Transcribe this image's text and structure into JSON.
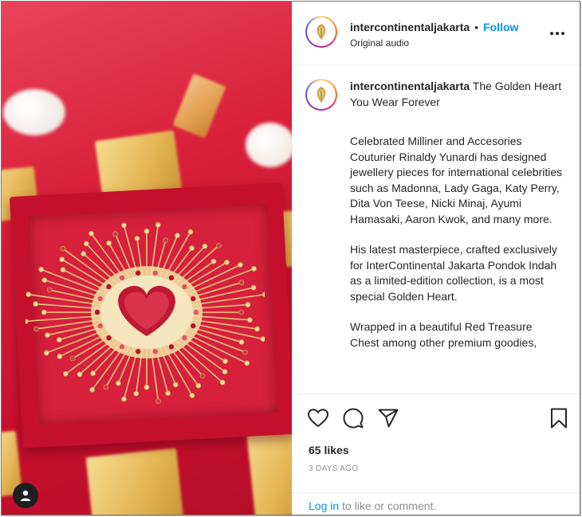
{
  "post": {
    "username": "intercontinentaljakarta",
    "follow_label": "Follow",
    "separator": "•",
    "audio": "Original audio",
    "more_label": "•••",
    "caption_title": "The Golden Heart You Wear Forever",
    "caption_paragraphs": [
      "Celebrated Milliner and Accesories Couturier Rinaldy Yunardi has designed jewellery pieces for international celebrities such as Madonna, Lady Gaga, Katy Perry, Dita Von Teese, Nicki Minaj, Ayumi Hamasaki, Aaron Kwok, and many more.",
      "His latest masterpiece, crafted exclusively for InterContinental Jakarta Pondok Indah as a limited-edition collection, is a most special Golden Heart.",
      "Wrapped in a beautiful Red Treasure Chest among other premium goodies,"
    ],
    "likes": "65 likes",
    "time_ago": "3 DAYS AGO",
    "login_link": "Log in",
    "login_rest": " to like or comment."
  },
  "icons": {
    "like": "heart-icon",
    "comment": "comment-icon",
    "share": "share-icon",
    "save": "bookmark-icon",
    "user": "user-icon"
  },
  "colors": {
    "link": "#0095f6",
    "text": "#262626",
    "muted": "#8e8e8e",
    "media_red": "#c8102e",
    "gold": "#d4a84b"
  }
}
